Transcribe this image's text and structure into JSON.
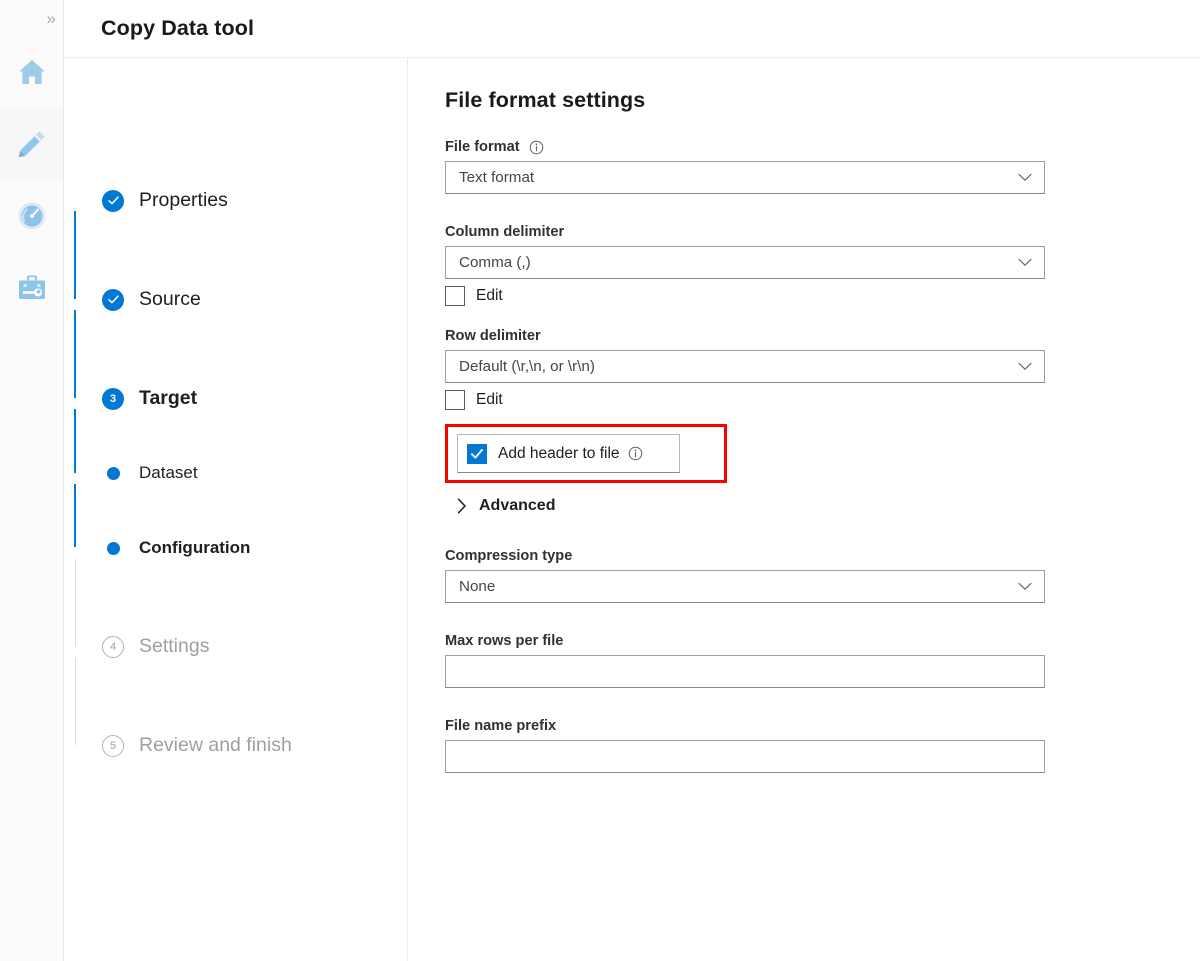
{
  "app": {
    "title": "Copy Data tool",
    "expand_icon": "chevron-double-right-icon"
  },
  "rail": {
    "items": [
      {
        "id": "home",
        "icon": "home-icon",
        "label": "Home",
        "active": false
      },
      {
        "id": "author",
        "icon": "pencil-icon",
        "label": "Author",
        "active": true
      },
      {
        "id": "monitor",
        "icon": "monitor-icon",
        "label": "Monitor",
        "active": false
      },
      {
        "id": "manage",
        "icon": "toolbox-icon",
        "label": "Manage",
        "active": false
      }
    ]
  },
  "wizard": {
    "steps": [
      {
        "label": "Properties",
        "state": "complete",
        "marker": "check",
        "level": "major"
      },
      {
        "label": "Source",
        "state": "complete",
        "marker": "check",
        "level": "major"
      },
      {
        "label": "Target",
        "state": "current",
        "marker": "3",
        "level": "major"
      },
      {
        "label": "Dataset",
        "state": "done",
        "marker": "dot",
        "level": "sub"
      },
      {
        "label": "Configuration",
        "state": "active",
        "marker": "dot",
        "level": "sub"
      },
      {
        "label": "Settings",
        "state": "future",
        "marker": "4",
        "level": "major"
      },
      {
        "label": "Review and finish",
        "state": "future",
        "marker": "5",
        "level": "major"
      }
    ]
  },
  "panel": {
    "heading": "File format settings",
    "file_format": {
      "label": "File format",
      "info_icon": "info-icon",
      "value": "Text format",
      "chevron": "chevron-down-icon"
    },
    "column_delimiter": {
      "label": "Column delimiter",
      "value": "Comma (,)",
      "chevron": "chevron-down-icon",
      "edit_label": "Edit",
      "edit_checked": false
    },
    "row_delimiter": {
      "label": "Row delimiter",
      "value": "Default (\\r,\\n, or \\r\\n)",
      "chevron": "chevron-down-icon",
      "edit_label": "Edit",
      "edit_checked": false
    },
    "add_header": {
      "label": "Add header to file",
      "checked": true,
      "info_icon": "info-icon",
      "highlight_color": "#ff0000"
    },
    "advanced": {
      "label": "Advanced",
      "chevron": "chevron-right-icon",
      "expanded": false
    },
    "compression_type": {
      "label": "Compression type",
      "value": "None",
      "chevron": "chevron-down-icon"
    },
    "max_rows_per_file": {
      "label": "Max rows per file",
      "value": "",
      "placeholder": ""
    },
    "file_name_prefix": {
      "label": "File name prefix",
      "value": "",
      "placeholder": ""
    }
  },
  "colors": {
    "accent": "#0078d4",
    "highlight": "#ff0000",
    "icon_blue": "#92c5ea",
    "text": "#201f1e",
    "muted_text": "#a19f9d"
  }
}
